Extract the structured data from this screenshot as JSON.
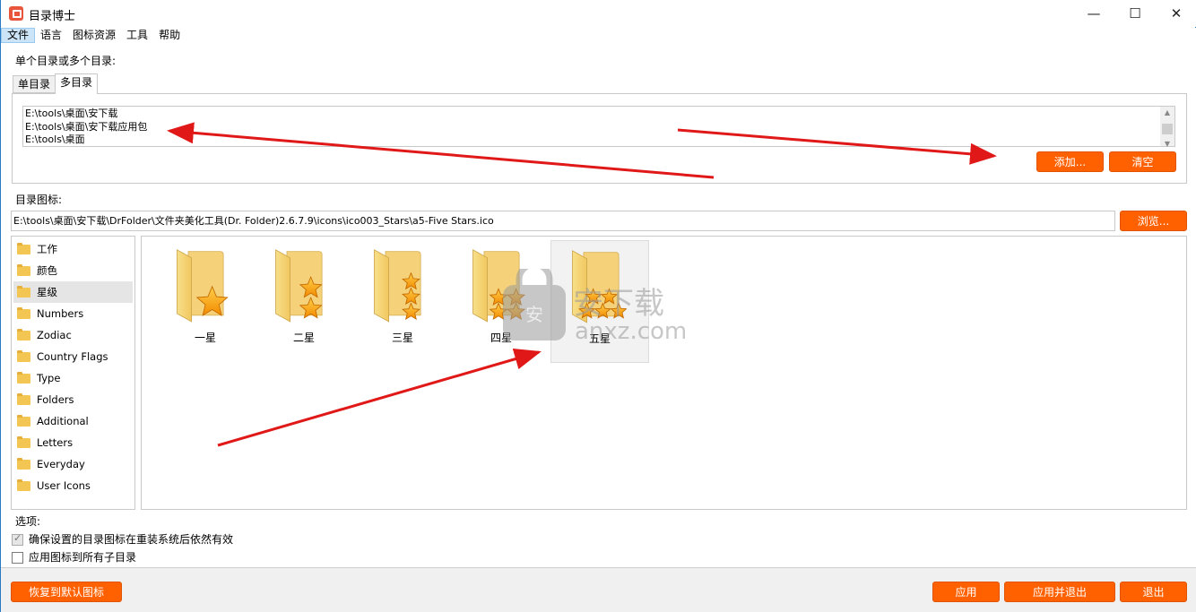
{
  "window": {
    "title": "目录博士",
    "minimize_icon": "minimize-icon",
    "maximize_icon": "maximize-icon",
    "close_icon": "close-icon"
  },
  "menu": [
    "文件",
    "语言",
    "图标资源",
    "工具",
    "帮助"
  ],
  "dirs": {
    "label": "单个目录或多个目录:",
    "tabs": [
      "单目录",
      "多目录"
    ],
    "selected_tab": "多目录",
    "lines": [
      "E:\\tools\\桌面\\安下载",
      "E:\\tools\\桌面\\安下载应用包",
      "E:\\tools\\桌面"
    ],
    "add_label": "添加...",
    "clear_label": "清空"
  },
  "icon": {
    "label": "目录图标:",
    "path": "E:\\tools\\桌面\\安下载\\DrFolder\\文件夹美化工具(Dr. Folder)2.6.7.9\\icons\\ico003_Stars\\a5-Five Stars.ico",
    "browse_label": "浏览..."
  },
  "categories": [
    "工作",
    "颜色",
    "星级",
    "Numbers",
    "Zodiac",
    "Country Flags",
    "Type",
    "Folders",
    "Additional",
    "Letters",
    "Everyday",
    "User Icons"
  ],
  "selected_category": "星级",
  "icons": [
    {
      "label": "一星",
      "stars": 1
    },
    {
      "label": "二星",
      "stars": 2
    },
    {
      "label": "三星",
      "stars": 3
    },
    {
      "label": "四星",
      "stars": 4
    },
    {
      "label": "五星",
      "stars": 5
    }
  ],
  "selected_icon": "五星",
  "options": {
    "label": "选项:",
    "items": [
      {
        "label": "确保设置的目录图标在重装系统后依然有效",
        "checked": true
      },
      {
        "label": "应用图标到所有子目录",
        "checked": false
      }
    ]
  },
  "footer": {
    "restore_label": "恢复到默认图标",
    "apply_label": "应用",
    "apply_exit_label": "应用并退出",
    "exit_label": "退出"
  },
  "watermark": {
    "text": "安下载",
    "sub": "anxz.com"
  },
  "colors": {
    "accent": "#ff6100",
    "annotation_arrow": "#e01818"
  }
}
